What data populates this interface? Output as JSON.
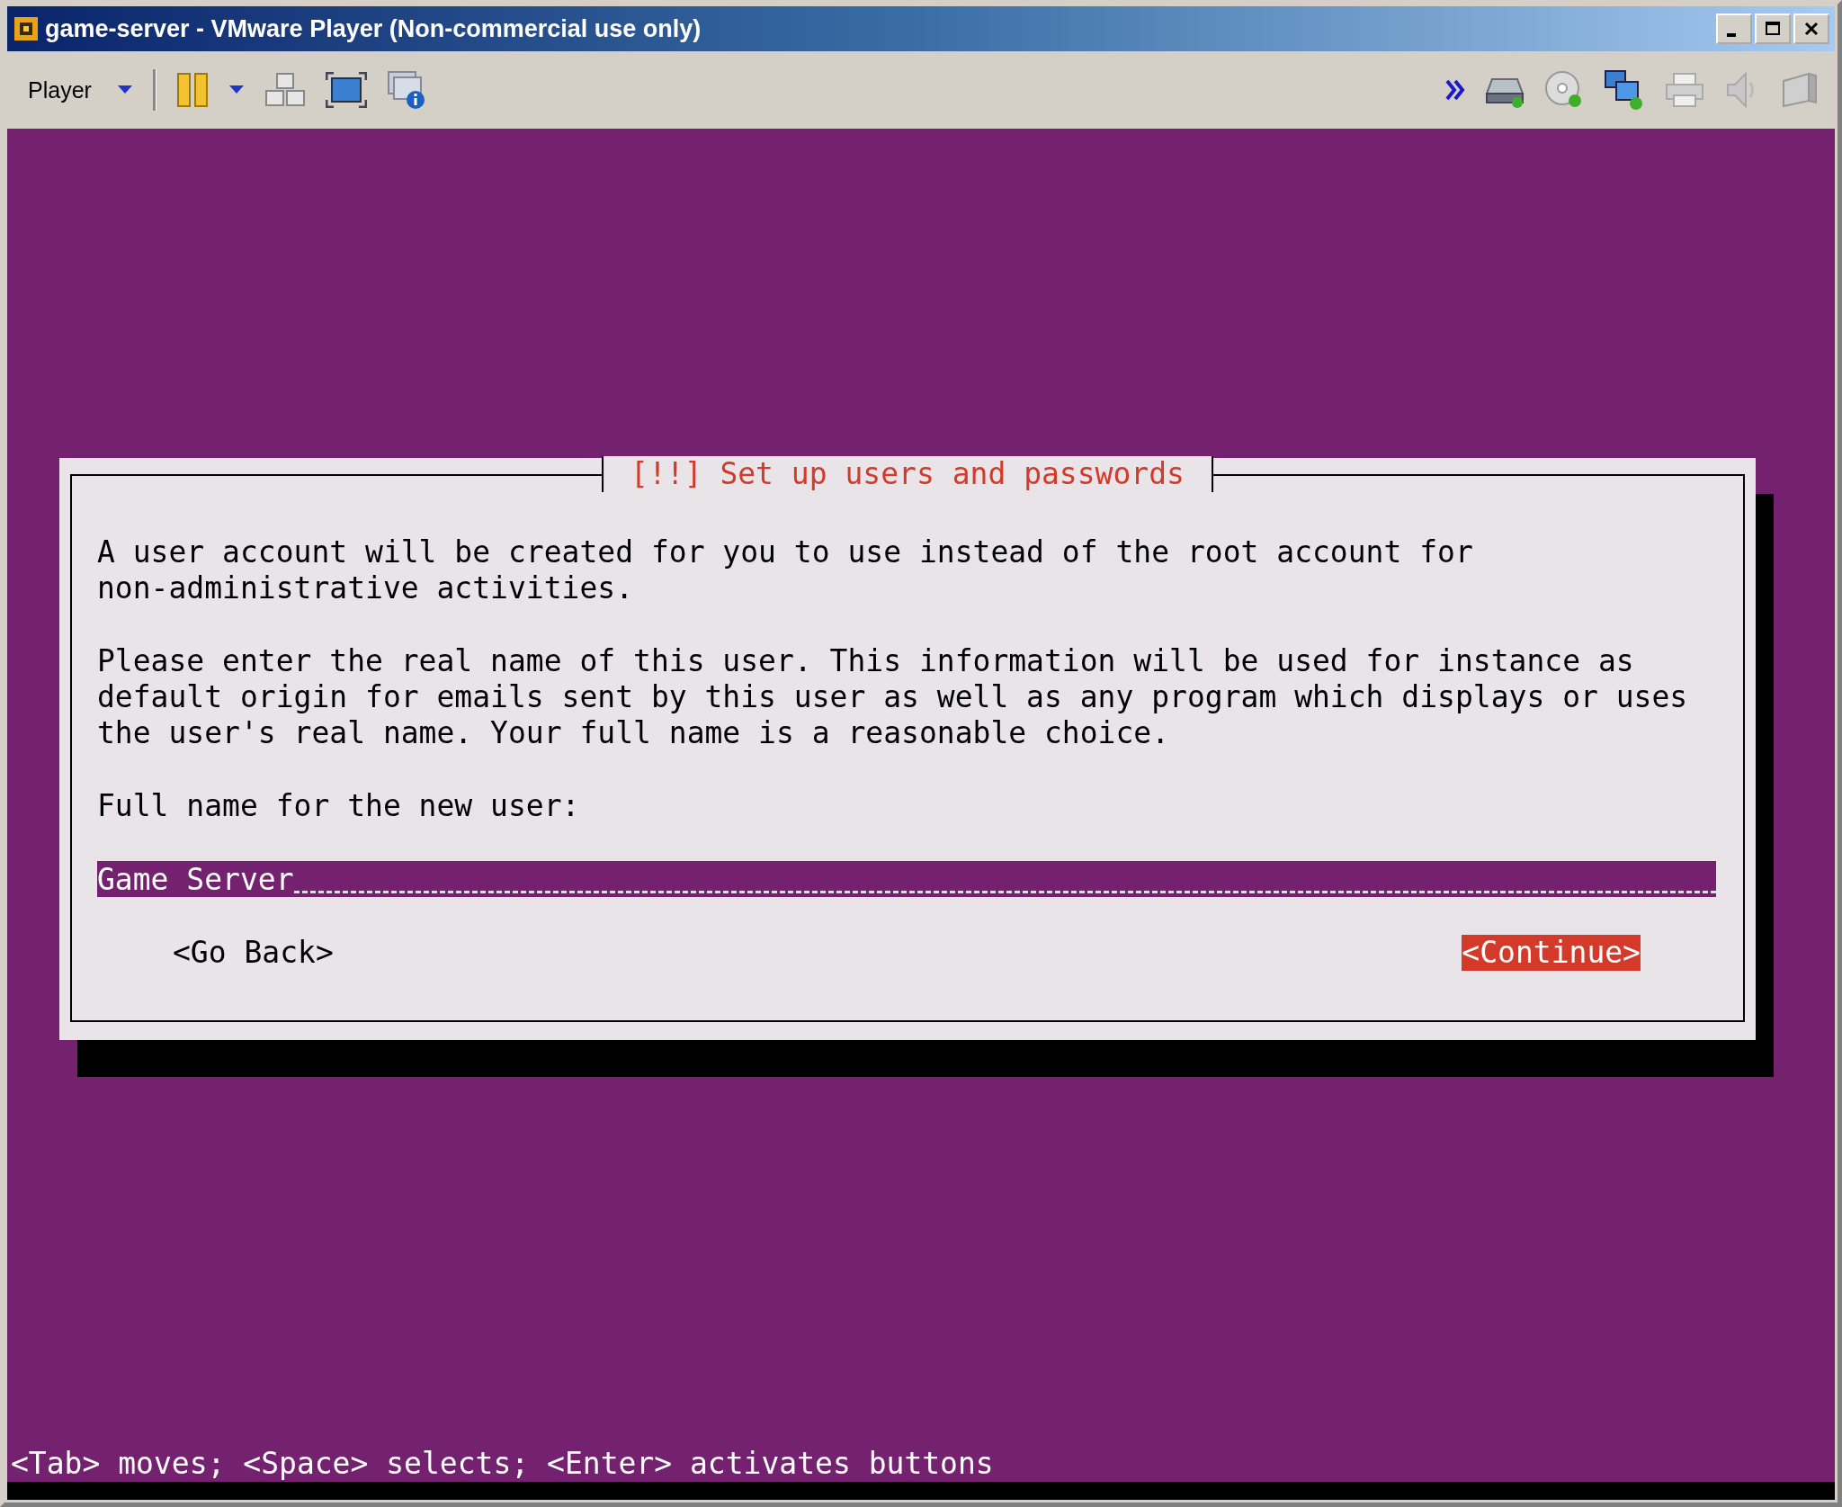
{
  "window": {
    "title": "game-server - VMware Player (Non-commercial use only)"
  },
  "toolbar": {
    "menu_label": "Player"
  },
  "dialog": {
    "title": "[!!] Set up users and passwords",
    "paragraphs": [
      "A user account will be created for you to use instead of the root account for\nnon-administrative activities.",
      "Please enter the real name of this user. This information will be used for instance as\ndefault origin for emails sent by this user as well as any program which displays or uses\nthe user's real name. Your full name is a reasonable choice."
    ],
    "field_label": "Full name for the new user:",
    "field_value": "Game Server",
    "buttons": [
      {
        "label": "<Go Back>",
        "selected": false
      },
      {
        "label": "<Continue>",
        "selected": true
      }
    ]
  },
  "status_bar": "<Tab> moves; <Space> selects; <Enter> activates buttons"
}
